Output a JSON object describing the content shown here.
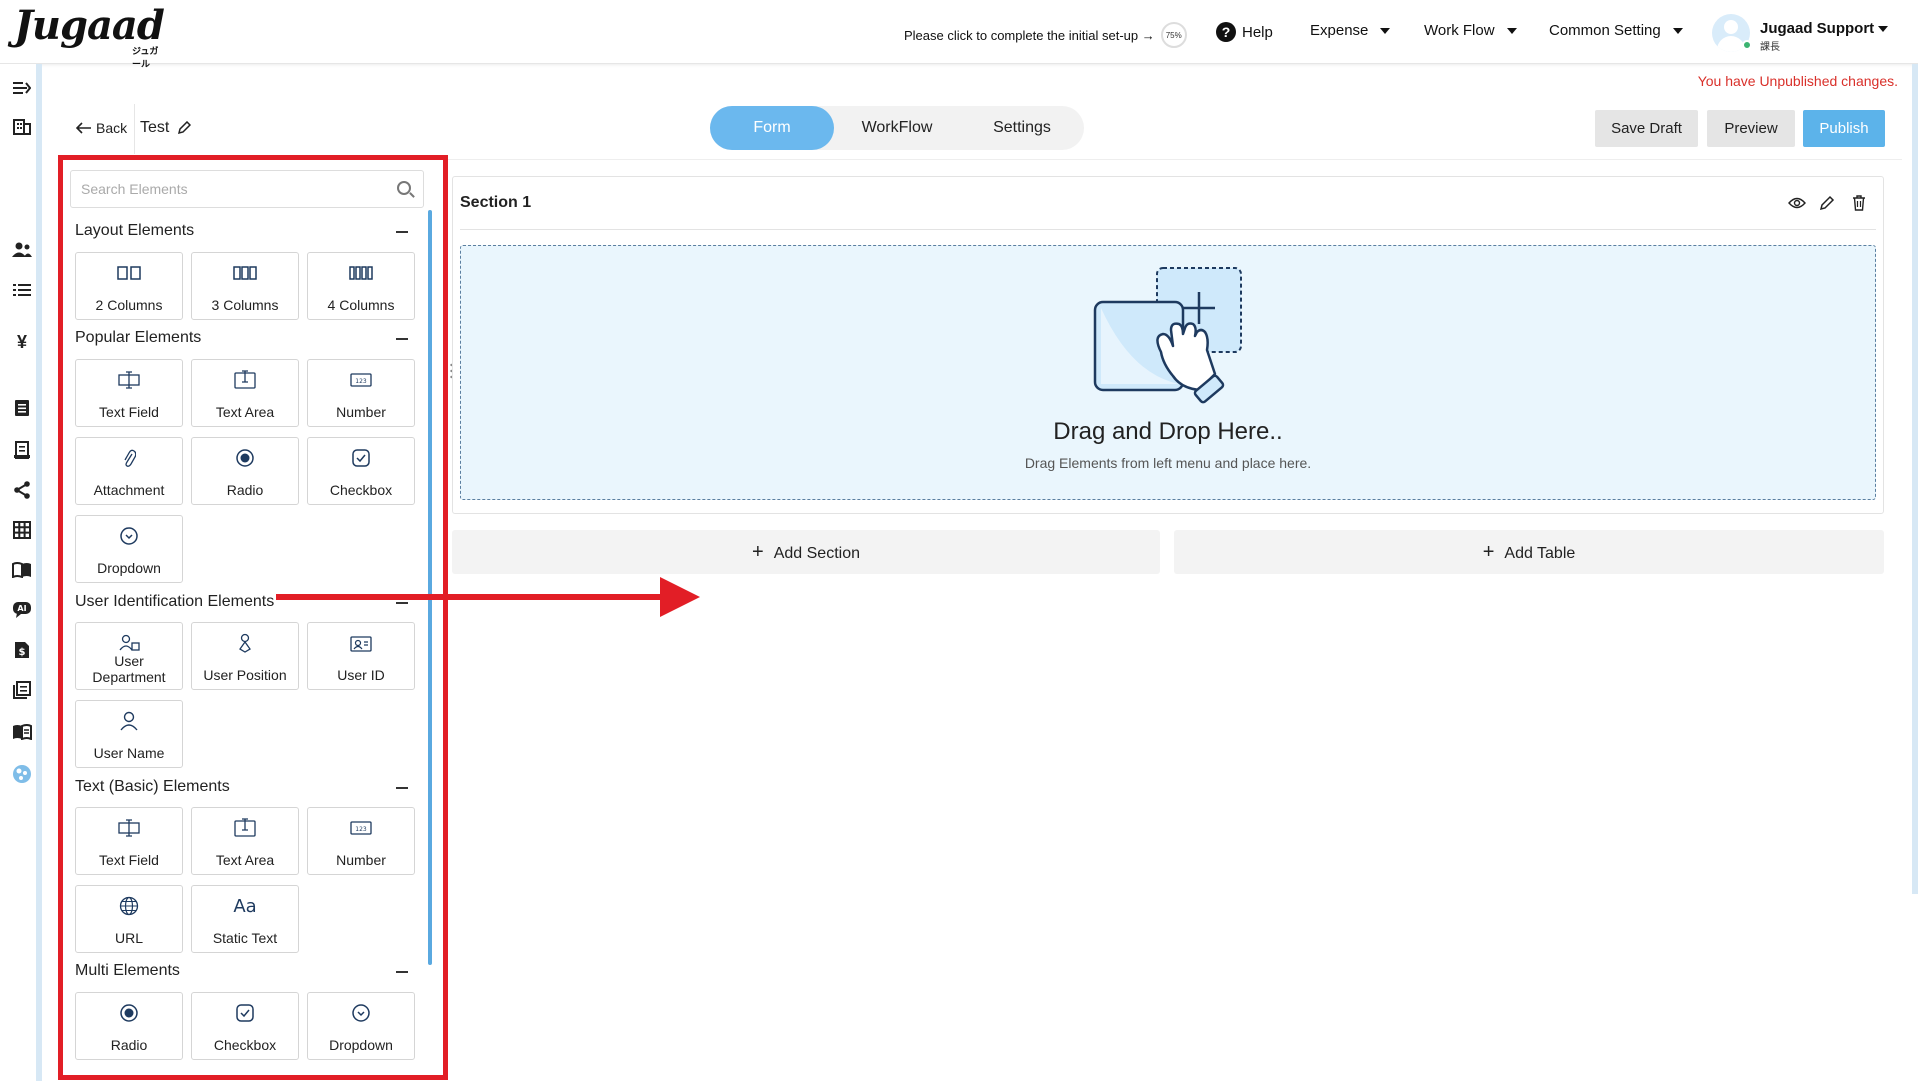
{
  "app": {
    "logo_text": "Jugaad",
    "logo_sub": "ジュガール",
    "setup_text": "Please click to complete the initial set-up →",
    "setup_percent": "75%",
    "nav": {
      "help": "Help",
      "expense": "Expense",
      "workflow": "Work Flow",
      "common_setting": "Common Setting"
    },
    "user": {
      "name": "Jugaad Support",
      "role": "課長"
    },
    "unpublished_notice": "You have Unpublished changes."
  },
  "sidebar_icons": [
    "menu-expand-icon",
    "building-icon",
    "users-icon",
    "list-icon",
    "yen-icon",
    "document-icon",
    "receipt-icon",
    "share-icon",
    "grid-icon",
    "book-open-icon",
    "ai-chat-icon",
    "invoice-icon",
    "reports-icon",
    "manual-icon",
    "globe-icon"
  ],
  "builder": {
    "back_label": "Back",
    "form_title": "Test",
    "tabs": [
      {
        "label": "Form",
        "active": true
      },
      {
        "label": "WorkFlow",
        "active": false
      },
      {
        "label": "Settings",
        "active": false
      }
    ],
    "save_draft": "Save Draft",
    "preview": "Preview",
    "publish": "Publish"
  },
  "palette": {
    "search_placeholder": "Search Elements",
    "groups": {
      "layout": {
        "title": "Layout Elements",
        "items": [
          "2 Columns",
          "3 Columns",
          "4 Columns"
        ]
      },
      "popular": {
        "title": "Popular Elements",
        "items": [
          "Text Field",
          "Text Area",
          "Number",
          "Attachment",
          "Radio",
          "Checkbox",
          "Dropdown"
        ]
      },
      "user_ident": {
        "title": "User Identification Elements",
        "items": [
          "User Department",
          "User Position",
          "User ID",
          "User Name"
        ]
      },
      "text_basic": {
        "title": "Text (Basic) Elements",
        "items": [
          "Text Field",
          "Text Area",
          "Number",
          "URL",
          "Static Text"
        ]
      },
      "multi": {
        "title": "Multi Elements",
        "items": [
          "Radio",
          "Checkbox",
          "Dropdown"
        ]
      }
    }
  },
  "canvas": {
    "section_title": "Section 1",
    "drop_title": "Drag and Drop Here..",
    "drop_subtitle": "Drag Elements from left menu and place here.",
    "add_section": "Add Section",
    "add_table": "Add Table"
  },
  "colors": {
    "accent": "#5cb3ea",
    "annotation": "#e21e26",
    "warning": "#d9302a",
    "drop_bg": "#eaf6fd"
  }
}
